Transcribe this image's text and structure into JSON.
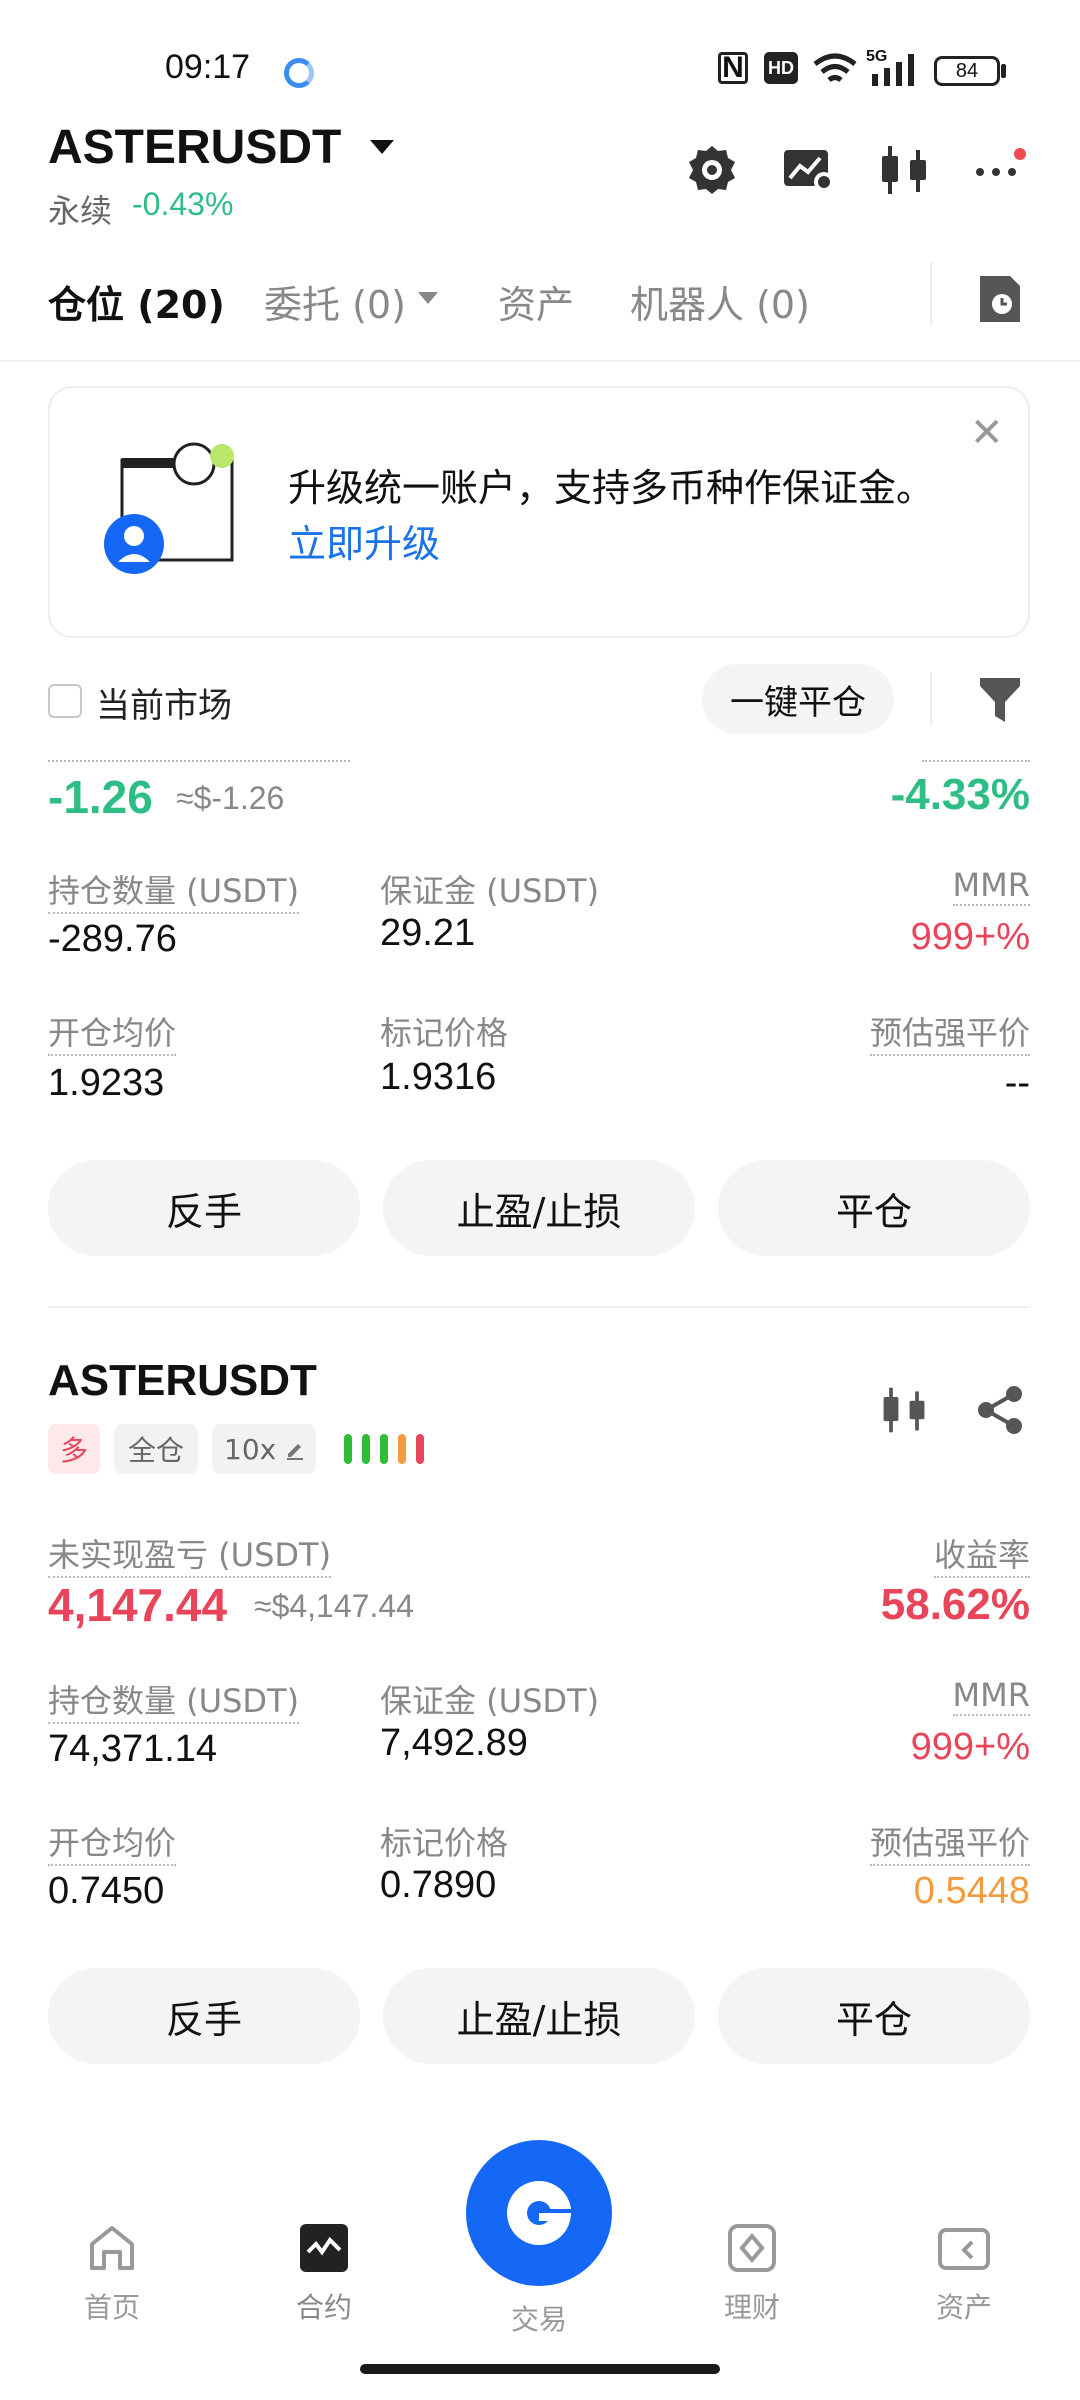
{
  "status_bar": {
    "time": "09:17",
    "nfc": "N",
    "hd": "HD",
    "network": "5G",
    "battery": "84"
  },
  "header": {
    "symbol": "ASTERUSDT",
    "contract_type": "永续",
    "change": "-0.43%"
  },
  "tabs": [
    {
      "label": "仓位 (20)"
    },
    {
      "label": "委托 (0)"
    },
    {
      "label": "资产"
    },
    {
      "label": "机器人 (0)"
    }
  ],
  "banner": {
    "text": "升级统一账户，支持多币种作保证金。",
    "link": "立即升级"
  },
  "filter": {
    "current_market_label": "当前市场",
    "close_all_label": "一键平仓"
  },
  "position1": {
    "pnl": "-1.26",
    "pnl_usd": "≈$-1.26",
    "roe": "-4.33%",
    "qty_label": "持仓数量 (USDT)",
    "qty": "-289.76",
    "margin_label": "保证金 (USDT)",
    "margin": "29.21",
    "mmr_label": "MMR",
    "mmr": "999+%",
    "entry_label": "开仓均价",
    "entry": "1.9233",
    "mark_label": "标记价格",
    "mark": "1.9316",
    "liq_label": "预估强平价",
    "liq": "--",
    "btn_reverse": "反手",
    "btn_tpsl": "止盈/止损",
    "btn_close": "平仓"
  },
  "position2": {
    "symbol": "ASTERUSDT",
    "side_tag": "多",
    "margin_mode_tag": "全仓",
    "leverage_tag": "10x",
    "pnl_label": "未实现盈亏 (USDT)",
    "pnl": "4,147.44",
    "pnl_usd": "≈$4,147.44",
    "roe_label": "收益率",
    "roe": "58.62%",
    "qty_label": "持仓数量 (USDT)",
    "qty": "74,371.14",
    "margin_label": "保证金 (USDT)",
    "margin": "7,492.89",
    "mmr_label": "MMR",
    "mmr": "999+%",
    "entry_label": "开仓均价",
    "entry": "0.7450",
    "mark_label": "标记价格",
    "mark": "0.7890",
    "liq_label": "预估强平价",
    "liq": "0.5448",
    "btn_reverse": "反手",
    "btn_tpsl": "止盈/止损",
    "btn_close": "平仓"
  },
  "bottom_nav": [
    {
      "label": "首页",
      "icon": "home-icon"
    },
    {
      "label": "合约",
      "icon": "futures-icon"
    },
    {
      "label": "交易",
      "icon": "trade-icon"
    },
    {
      "label": "理财",
      "icon": "earn-icon"
    },
    {
      "label": "资产",
      "icon": "assets-icon"
    }
  ],
  "colors": {
    "up": "#2ebd85",
    "down": "#e8455a",
    "warn": "#f39c3d",
    "brand": "#1468f5",
    "link": "#1a73e8"
  }
}
